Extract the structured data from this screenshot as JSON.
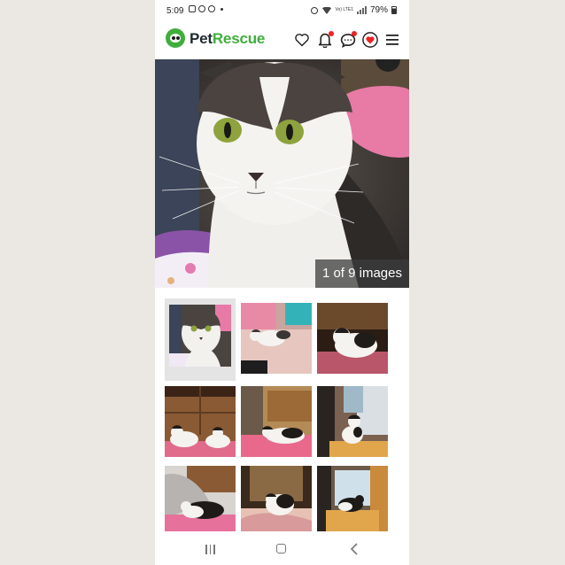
{
  "status_bar": {
    "time": "5:09",
    "battery": "79%",
    "network": "Vo) LTE1"
  },
  "header": {
    "brand_part1": "Pet",
    "brand_part2": "Rescue",
    "brand_color": "#3fae3b",
    "icons": [
      "heart-icon",
      "bell-icon",
      "chat-icon",
      "favourites-icon",
      "menu-icon"
    ]
  },
  "hero": {
    "caption": "1 of 9 images"
  },
  "thumbnails": {
    "count": 9,
    "selected_index": 0
  },
  "colors": {
    "accent": "#3fae3b",
    "notification": "#e22222"
  }
}
